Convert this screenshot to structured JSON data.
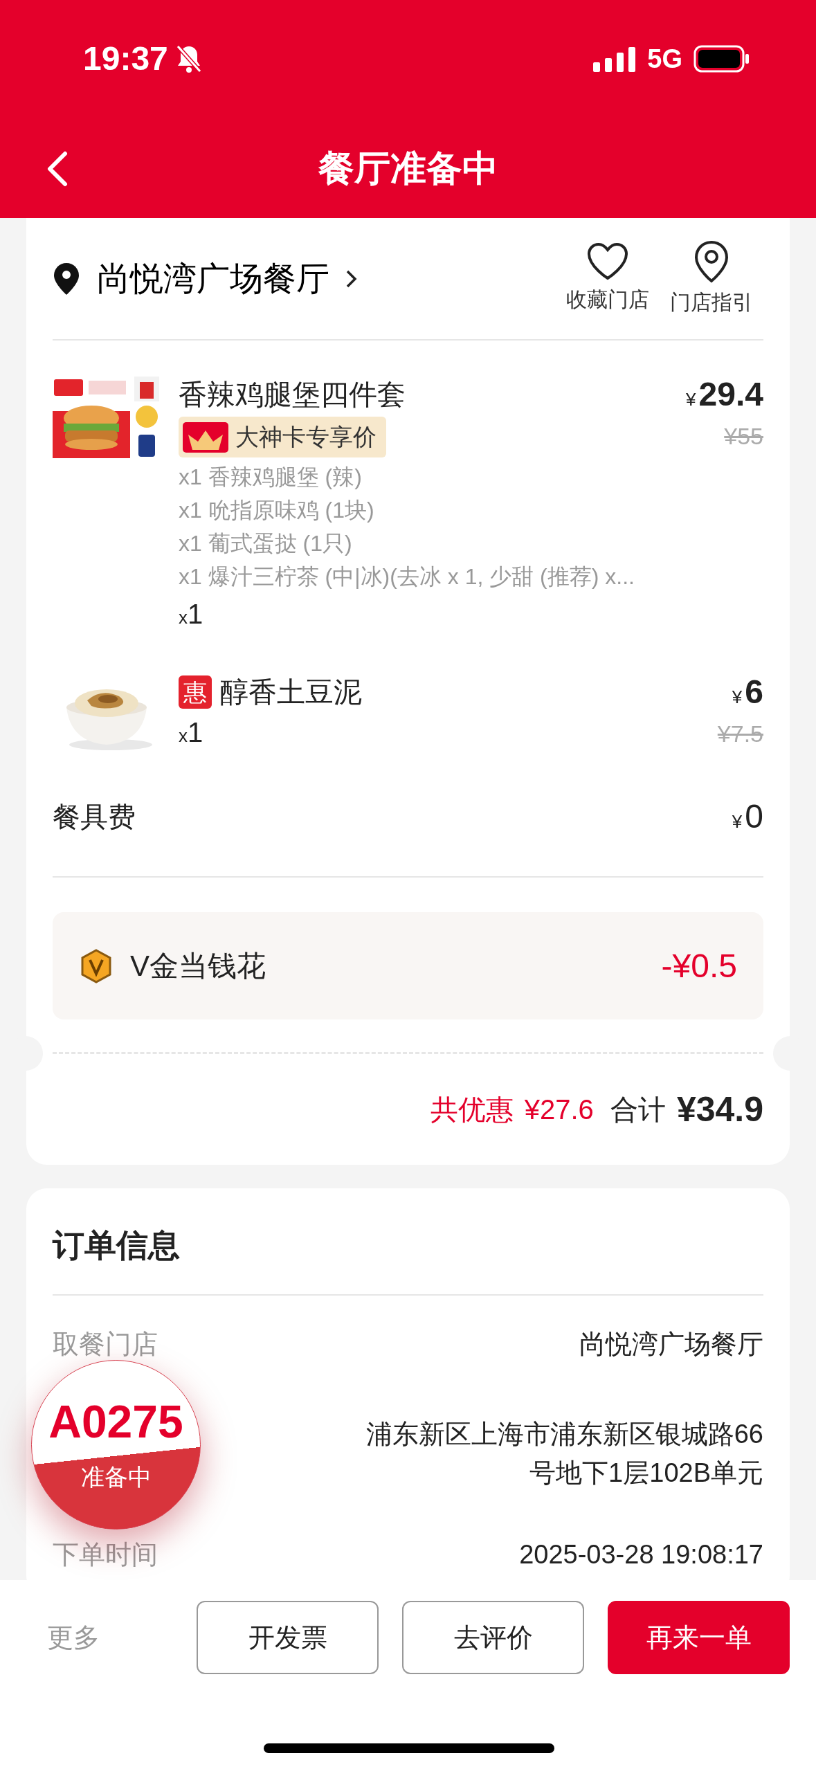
{
  "status_bar": {
    "time": "19:37",
    "network": "5G"
  },
  "header": {
    "title": "餐厅准备中"
  },
  "store": {
    "name": "尚悦湾广场餐厅",
    "actions": [
      {
        "label": "收藏门店",
        "kind": "heart"
      },
      {
        "label": "门店指引",
        "kind": "pin"
      }
    ]
  },
  "items": [
    {
      "kind": "combo",
      "name": "香辣鸡腿堡四件套",
      "tag": "大神卡专享价",
      "currency": "¥",
      "price": "29.4",
      "original_price": "¥55",
      "details": [
        "x1 香辣鸡腿堡 (辣)",
        "x1 吮指原味鸡 (1块)",
        "x1 葡式蛋挞 (1只)",
        "x1 爆汁三柠茶 (中|冰)(去冰 x 1, 少甜 (推荐) x..."
      ],
      "qty_mark": "x",
      "quantity": "1"
    },
    {
      "kind": "single",
      "name": "醇香土豆泥",
      "badge": "惠",
      "currency": "¥",
      "price": "6",
      "original_price": "¥7.5",
      "qty_mark": "x",
      "quantity": "1"
    }
  ],
  "fee": {
    "label": "餐具费",
    "currency": "¥",
    "amount": "0"
  },
  "discount": {
    "label": "V金当钱花",
    "amount": "-¥0.5"
  },
  "totals": {
    "savings_label": "共优惠",
    "savings": "¥27.6",
    "total_label": "合计",
    "total": "¥34.9"
  },
  "order_info": {
    "title": "订单信息",
    "rows": [
      {
        "label": "取餐门店",
        "value_lines": [
          "尚悦湾广场餐厅"
        ]
      },
      {
        "value_lines": [
          "浦东新区上海市浦东新区银城路66",
          "号地下1层102B单元"
        ]
      },
      {
        "label": "下单时间",
        "value_lines": [
          "2025-03-28 19:08:17"
        ]
      }
    ]
  },
  "pickup_badge": {
    "code": "A0275",
    "status": "准备中"
  },
  "bottom_bar": {
    "more": "更多",
    "buttons": [
      {
        "label": "开发票",
        "kind": "outline"
      },
      {
        "label": "去评价",
        "kind": "outline"
      },
      {
        "label": "再来一单",
        "kind": "primary"
      }
    ]
  }
}
